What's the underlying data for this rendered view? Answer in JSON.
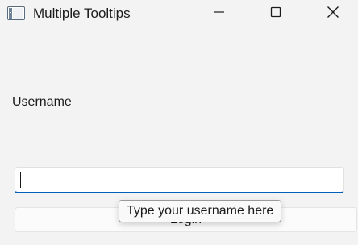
{
  "window": {
    "title": "Multiple Tooltips",
    "icons": {
      "app": "app-window-icon",
      "minimize": "minimize-icon",
      "maximize": "maximize-icon",
      "close": "close-icon"
    }
  },
  "form": {
    "username_label": "Username",
    "username_value": "",
    "login_label": "Login",
    "tooltip_text": "Type your username here"
  },
  "colors": {
    "background": "#f3f3f3",
    "input_focus_accent": "#005fb8"
  }
}
